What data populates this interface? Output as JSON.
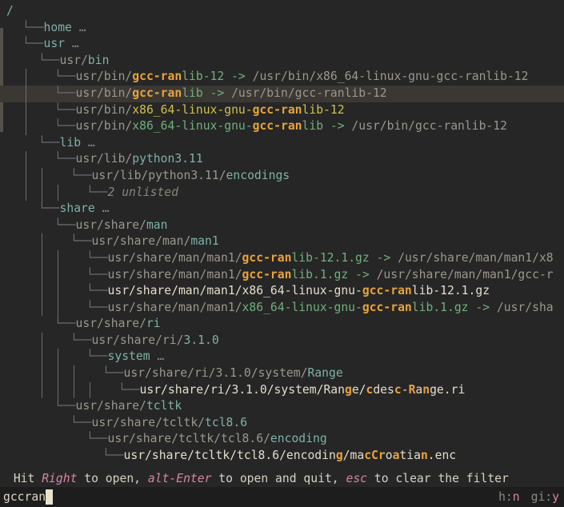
{
  "app": {
    "background": "#262626",
    "selected_row_background": "#3b3733",
    "match_color": "#e8a33d",
    "dir_color": "#7fb0a8",
    "link_color": "#6faf7d",
    "exe_color": "#cfc14a",
    "dim_color": "#9c978c",
    "key_color": "#d884a8"
  },
  "tree": {
    "root_label": "/",
    "rows": [
      {
        "indent": 0,
        "branch": "",
        "kind": "root",
        "selected": false,
        "segments": [
          {
            "text": "/",
            "style": "root"
          }
        ]
      },
      {
        "indent": 1,
        "branch": "└──",
        "kind": "dir-collapsed",
        "selected": false,
        "segments": [
          {
            "text": "home",
            "style": "dir"
          },
          {
            "text": " …",
            "style": "ell"
          }
        ]
      },
      {
        "indent": 1,
        "branch": "└──",
        "kind": "dir-collapsed",
        "selected": false,
        "segments": [
          {
            "text": "usr",
            "style": "dir"
          },
          {
            "text": " …",
            "style": "ell"
          }
        ]
      },
      {
        "indent": 2,
        "branch": "└──",
        "kind": "dir",
        "selected": false,
        "segments": [
          {
            "text": "usr/",
            "style": "dim"
          },
          {
            "text": "bin",
            "style": "dir"
          }
        ]
      },
      {
        "indent": 3,
        "branch": "└──",
        "kind": "symlink",
        "selected": false,
        "segments": [
          {
            "text": "usr/bin/",
            "style": "dim"
          },
          {
            "text": "gcc-ran",
            "style": "match"
          },
          {
            "text": "lib-12",
            "style": "link"
          },
          {
            "text": " -> ",
            "style": "link"
          },
          {
            "text": "/usr/bin/x86_64-linux-gnu-gcc-ranlib-12",
            "style": "dim"
          }
        ]
      },
      {
        "indent": 3,
        "branch": "└──",
        "kind": "symlink",
        "selected": true,
        "segments": [
          {
            "text": "usr/bin/",
            "style": "dim"
          },
          {
            "text": "gcc-ran",
            "style": "match"
          },
          {
            "text": "lib",
            "style": "link"
          },
          {
            "text": " -> ",
            "style": "link"
          },
          {
            "text": "/usr/bin/gcc-ranlib-12",
            "style": "dim"
          }
        ]
      },
      {
        "indent": 3,
        "branch": "└──",
        "kind": "executable",
        "selected": false,
        "segments": [
          {
            "text": "usr/bin/",
            "style": "dim"
          },
          {
            "text": "x86_64-linux-gnu-",
            "style": "exe"
          },
          {
            "text": "gcc-ran",
            "style": "match"
          },
          {
            "text": "lib-12",
            "style": "exe"
          }
        ]
      },
      {
        "indent": 3,
        "branch": "└──",
        "kind": "symlink",
        "selected": false,
        "segments": [
          {
            "text": "usr/bin/",
            "style": "dim"
          },
          {
            "text": "x86_64-linux-gnu-",
            "style": "link"
          },
          {
            "text": "gcc-ran",
            "style": "match"
          },
          {
            "text": "lib",
            "style": "link"
          },
          {
            "text": " -> ",
            "style": "link"
          },
          {
            "text": "/usr/bin/gcc-ranlib-12",
            "style": "dim"
          }
        ]
      },
      {
        "indent": 2,
        "branch": "└──",
        "kind": "dir-collapsed",
        "selected": false,
        "segments": [
          {
            "text": "lib",
            "style": "dir"
          },
          {
            "text": " …",
            "style": "ell"
          }
        ]
      },
      {
        "indent": 3,
        "branch": "└──",
        "kind": "dir",
        "selected": false,
        "segments": [
          {
            "text": "usr/lib/",
            "style": "dim"
          },
          {
            "text": "python3.11",
            "style": "dir"
          }
        ]
      },
      {
        "indent": 4,
        "branch": "└──",
        "kind": "dir",
        "selected": false,
        "segments": [
          {
            "text": "usr/lib/python3.11/",
            "style": "dim"
          },
          {
            "text": "encodings",
            "style": "dir"
          }
        ]
      },
      {
        "indent": 5,
        "branch": "└──",
        "kind": "unlisted",
        "selected": false,
        "segments": [
          {
            "text": "2 unlisted",
            "style": "unlisted"
          }
        ]
      },
      {
        "indent": 2,
        "branch": "└──",
        "kind": "dir-collapsed",
        "selected": false,
        "segments": [
          {
            "text": "share",
            "style": "dir"
          },
          {
            "text": " …",
            "style": "ell"
          }
        ]
      },
      {
        "indent": 3,
        "branch": "└──",
        "kind": "dir",
        "selected": false,
        "segments": [
          {
            "text": "usr/share/",
            "style": "dim"
          },
          {
            "text": "man",
            "style": "dir"
          }
        ]
      },
      {
        "indent": 4,
        "branch": "└──",
        "kind": "dir",
        "selected": false,
        "segments": [
          {
            "text": "usr/share/man/",
            "style": "dim"
          },
          {
            "text": "man1",
            "style": "dir"
          }
        ]
      },
      {
        "indent": 5,
        "branch": "└──",
        "kind": "symlink",
        "selected": false,
        "segments": [
          {
            "text": "usr/share/man/man1/",
            "style": "dim"
          },
          {
            "text": "gcc-ran",
            "style": "match"
          },
          {
            "text": "lib-12.1.gz",
            "style": "link"
          },
          {
            "text": " -> ",
            "style": "link"
          },
          {
            "text": "/usr/share/man/man1/x8",
            "style": "dim"
          }
        ]
      },
      {
        "indent": 5,
        "branch": "└──",
        "kind": "symlink",
        "selected": false,
        "segments": [
          {
            "text": "usr/share/man/man1/",
            "style": "dim"
          },
          {
            "text": "gcc-ran",
            "style": "match"
          },
          {
            "text": "lib.1.gz",
            "style": "link"
          },
          {
            "text": " -> ",
            "style": "link"
          },
          {
            "text": "/usr/share/man/man1/gcc-r",
            "style": "dim"
          }
        ]
      },
      {
        "indent": 5,
        "branch": "└──",
        "kind": "file",
        "selected": false,
        "segments": [
          {
            "text": "usr/share/man/man1/x86_64-linux-gnu-",
            "style": "file"
          },
          {
            "text": "gcc-ran",
            "style": "match"
          },
          {
            "text": "lib-12.1.gz",
            "style": "file"
          }
        ]
      },
      {
        "indent": 5,
        "branch": "└──",
        "kind": "symlink",
        "selected": false,
        "segments": [
          {
            "text": "usr/share/man/man1/",
            "style": "dim"
          },
          {
            "text": "x86_64-linux-gnu-",
            "style": "link"
          },
          {
            "text": "gcc-ran",
            "style": "match"
          },
          {
            "text": "lib.1.gz",
            "style": "link"
          },
          {
            "text": " -> ",
            "style": "link"
          },
          {
            "text": "/usr/sha",
            "style": "dim"
          }
        ]
      },
      {
        "indent": 3,
        "branch": "└──",
        "kind": "dir",
        "selected": false,
        "segments": [
          {
            "text": "usr/share/",
            "style": "dim"
          },
          {
            "text": "ri",
            "style": "dir"
          }
        ]
      },
      {
        "indent": 4,
        "branch": "└──",
        "kind": "dir",
        "selected": false,
        "segments": [
          {
            "text": "usr/share/ri/",
            "style": "dim"
          },
          {
            "text": "3.1.0",
            "style": "dir"
          }
        ]
      },
      {
        "indent": 5,
        "branch": "└──",
        "kind": "dir-collapsed",
        "selected": false,
        "segments": [
          {
            "text": "system",
            "style": "dir"
          },
          {
            "text": " …",
            "style": "ell"
          }
        ]
      },
      {
        "indent": 6,
        "branch": "└──",
        "kind": "dir",
        "selected": false,
        "segments": [
          {
            "text": "usr/share/ri/3.1.0/system/",
            "style": "dim"
          },
          {
            "text": "Range",
            "style": "dir"
          }
        ]
      },
      {
        "indent": 7,
        "branch": "└──",
        "kind": "file",
        "selected": false,
        "segments": [
          {
            "text": "usr/share/ri/3.1.0/system/Ran",
            "style": "file"
          },
          {
            "text": "g",
            "style": "match"
          },
          {
            "text": "e/",
            "style": "file"
          },
          {
            "text": "c",
            "style": "match"
          },
          {
            "text": "des",
            "style": "file"
          },
          {
            "text": "c",
            "style": "match"
          },
          {
            "text": "-",
            "style": "file"
          },
          {
            "text": "R",
            "style": "match"
          },
          {
            "text": "a",
            "style": "file"
          },
          {
            "text": "n",
            "style": "match"
          },
          {
            "text": "ge.ri",
            "style": "file"
          }
        ]
      },
      {
        "indent": 3,
        "branch": "└──",
        "kind": "dir",
        "selected": false,
        "segments": [
          {
            "text": "usr/share/",
            "style": "dim"
          },
          {
            "text": "tcltk",
            "style": "dir"
          }
        ]
      },
      {
        "indent": 4,
        "branch": "└──",
        "kind": "dir",
        "selected": false,
        "segments": [
          {
            "text": "usr/share/tcltk/",
            "style": "dim"
          },
          {
            "text": "tcl8.6",
            "style": "dir"
          }
        ]
      },
      {
        "indent": 5,
        "branch": "└──",
        "kind": "dir",
        "selected": false,
        "segments": [
          {
            "text": "usr/share/tcltk/tcl8.6/",
            "style": "dim"
          },
          {
            "text": "encoding",
            "style": "dir"
          }
        ]
      },
      {
        "indent": 6,
        "branch": "└──",
        "kind": "file",
        "selected": false,
        "segments": [
          {
            "text": "usr/share/tcltk/tcl8.6/encodin",
            "style": "file"
          },
          {
            "text": "g",
            "style": "match"
          },
          {
            "text": "/ma",
            "style": "file"
          },
          {
            "text": "c",
            "style": "match"
          },
          {
            "text": "",
            "style": "file"
          },
          {
            "text": "C",
            "style": "match"
          },
          {
            "text": "",
            "style": "file"
          },
          {
            "text": "r",
            "style": "match"
          },
          {
            "text": "o",
            "style": "file"
          },
          {
            "text": "a",
            "style": "match"
          },
          {
            "text": "tia",
            "style": "file"
          },
          {
            "text": "n",
            "style": "match"
          },
          {
            "text": ".enc",
            "style": "file"
          }
        ]
      }
    ]
  },
  "hint": {
    "parts": [
      {
        "text": " Hit ",
        "style": "plain"
      },
      {
        "text": "Right",
        "style": "key"
      },
      {
        "text": " to open, ",
        "style": "plain"
      },
      {
        "text": "alt-Enter",
        "style": "key"
      },
      {
        "text": " to open and quit, ",
        "style": "plain"
      },
      {
        "text": "esc",
        "style": "key"
      },
      {
        "text": " to clear the filter",
        "style": "plain"
      }
    ]
  },
  "status": {
    "filter_value": "gccran",
    "filter_placeholder": "",
    "flags": [
      {
        "label": "h:",
        "value": "n"
      },
      {
        "label": "gi:",
        "value": "y"
      }
    ]
  },
  "scrollbar": {
    "thumb_top_pct": 6,
    "thumb_height_pct": 22
  }
}
